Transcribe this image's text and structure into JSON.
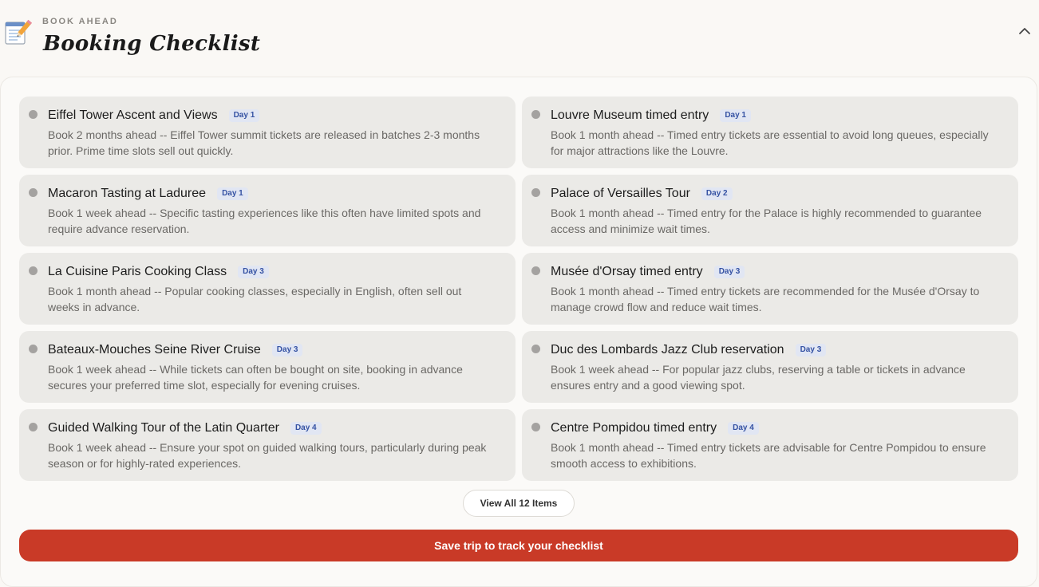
{
  "header": {
    "icon": "memo-pencil-icon",
    "eyebrow": "BOOK AHEAD",
    "title": "Booking Checklist",
    "collapse_icon": "chevron-up-icon"
  },
  "items": [
    {
      "title": "Eiffel Tower Ascent and Views",
      "day": "Day 1",
      "desc": "Book 2 months ahead -- Eiffel Tower summit tickets are released in batches 2-3 months prior. Prime time slots sell out quickly."
    },
    {
      "title": "Louvre Museum timed entry",
      "day": "Day 1",
      "desc": "Book 1 month ahead -- Timed entry tickets are essential to avoid long queues, especially for major attractions like the Louvre."
    },
    {
      "title": "Macaron Tasting at Laduree",
      "day": "Day 1",
      "desc": "Book 1 week ahead -- Specific tasting experiences like this often have limited spots and require advance reservation."
    },
    {
      "title": "Palace of Versailles Tour",
      "day": "Day 2",
      "desc": "Book 1 month ahead -- Timed entry for the Palace is highly recommended to guarantee access and minimize wait times."
    },
    {
      "title": "La Cuisine Paris Cooking Class",
      "day": "Day 3",
      "desc": "Book 1 month ahead -- Popular cooking classes, especially in English, often sell out weeks in advance."
    },
    {
      "title": "Musée d'Orsay timed entry",
      "day": "Day 3",
      "desc": "Book 1 month ahead -- Timed entry tickets are recommended for the Musée d'Orsay to manage crowd flow and reduce wait times."
    },
    {
      "title": "Bateaux-Mouches Seine River Cruise",
      "day": "Day 3",
      "desc": "Book 1 week ahead -- While tickets can often be bought on site, booking in advance secures your preferred time slot, especially for evening cruises."
    },
    {
      "title": "Duc des Lombards Jazz Club reservation",
      "day": "Day 3",
      "desc": "Book 1 week ahead -- For popular jazz clubs, reserving a table or tickets in advance ensures entry and a good viewing spot."
    },
    {
      "title": "Guided Walking Tour of the Latin Quarter",
      "day": "Day 4",
      "desc": "Book 1 week ahead -- Ensure your spot on guided walking tours, particularly during peak season or for highly-rated experiences."
    },
    {
      "title": "Centre Pompidou timed entry",
      "day": "Day 4",
      "desc": "Book 1 month ahead -- Timed entry tickets are advisable for Centre Pompidou to ensure smooth access to exhibitions."
    }
  ],
  "view_all_label": "View All 12 Items",
  "save_label": "Save trip to track your checklist",
  "colors": {
    "accent": "#c93a27",
    "badge_bg": "#e1e6f3",
    "badge_text": "#3552a3",
    "card_bg": "#ebeae7"
  }
}
